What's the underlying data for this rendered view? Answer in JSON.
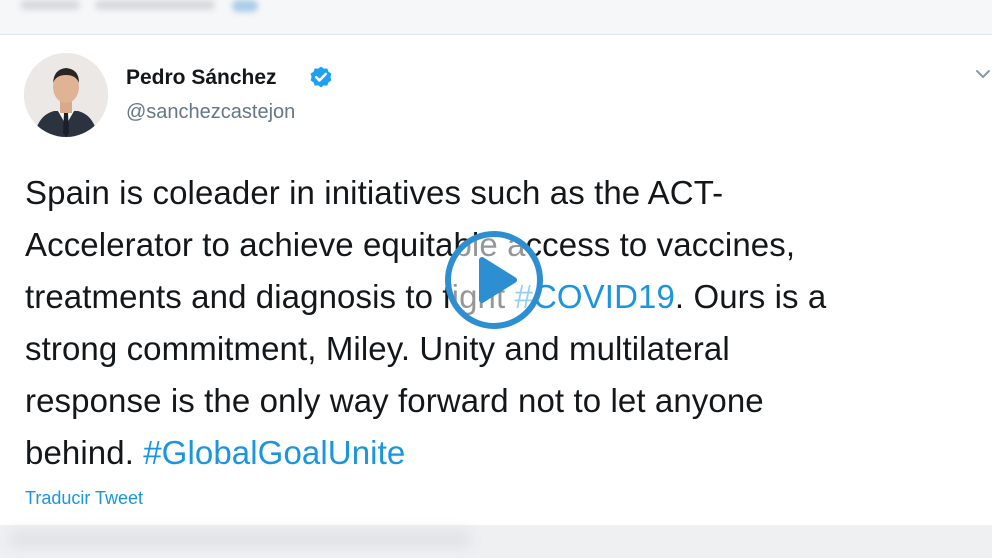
{
  "tweet": {
    "author_name": "Pedro Sánchez",
    "handle": "@sanchezcastejon",
    "text_lines": [
      [
        {
          "t": "Spain is coleader in initiatives such as the ACT-"
        }
      ],
      [
        {
          "t": "Accelerator to achieve equitable access to vaccines,"
        }
      ],
      [
        {
          "t": "treatments and diagnosis to fight "
        },
        {
          "t": "#COVID19",
          "tag": true
        },
        {
          "t": ". Ours is a"
        }
      ],
      [
        {
          "t": "strong commitment, Miley. Unity and multilateral"
        }
      ],
      [
        {
          "t": "response is the only way forward not to let anyone"
        }
      ],
      [
        {
          "t": "behind. "
        },
        {
          "t": "#GlobalGoalUnite",
          "tag": true
        }
      ]
    ],
    "translate_label": "Traducir Tweet"
  },
  "icons": {
    "verified": "verified-badge-icon",
    "chevron": "chevron-down-icon",
    "play": "play-icon"
  },
  "colors": {
    "accent": "#1b95e0",
    "text": "#14171a",
    "muted": "#657786",
    "verified": "#1da1f2"
  }
}
